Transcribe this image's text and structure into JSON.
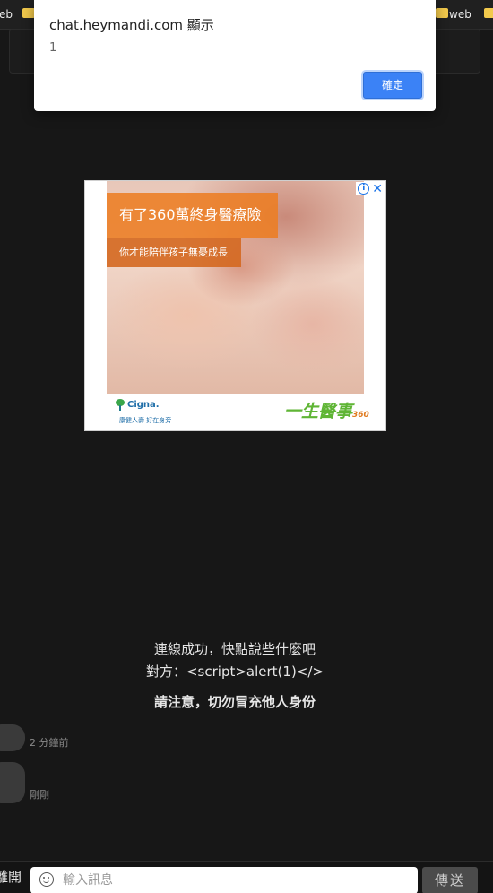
{
  "browser": {
    "bookmarks": [
      "eb",
      "web"
    ]
  },
  "dialog": {
    "title": "chat.heymandi.com 顯示",
    "message": "1",
    "ok_label": "確定"
  },
  "ad": {
    "headline": "有了360萬終身醫療險",
    "subline": "你才能陪伴孩子無憂成長",
    "cigna_brand": "Cigna.",
    "cigna_tagline": "康健人壽 好在身旁",
    "product_logo": "一生醫事",
    "product_logo_number": "360"
  },
  "chat": {
    "system_connected": "連線成功，快點說些什麼吧",
    "system_partner": "對方：<script>alert(1)</>",
    "system_warning": "請注意，切勿冒充他人身份",
    "messages": [
      {
        "timestamp": "2 分鐘前"
      },
      {
        "timestamp": "剛剛"
      }
    ]
  },
  "composer": {
    "leave_label": "離開",
    "placeholder": "輸入訊息",
    "send_label": "傳送"
  }
}
